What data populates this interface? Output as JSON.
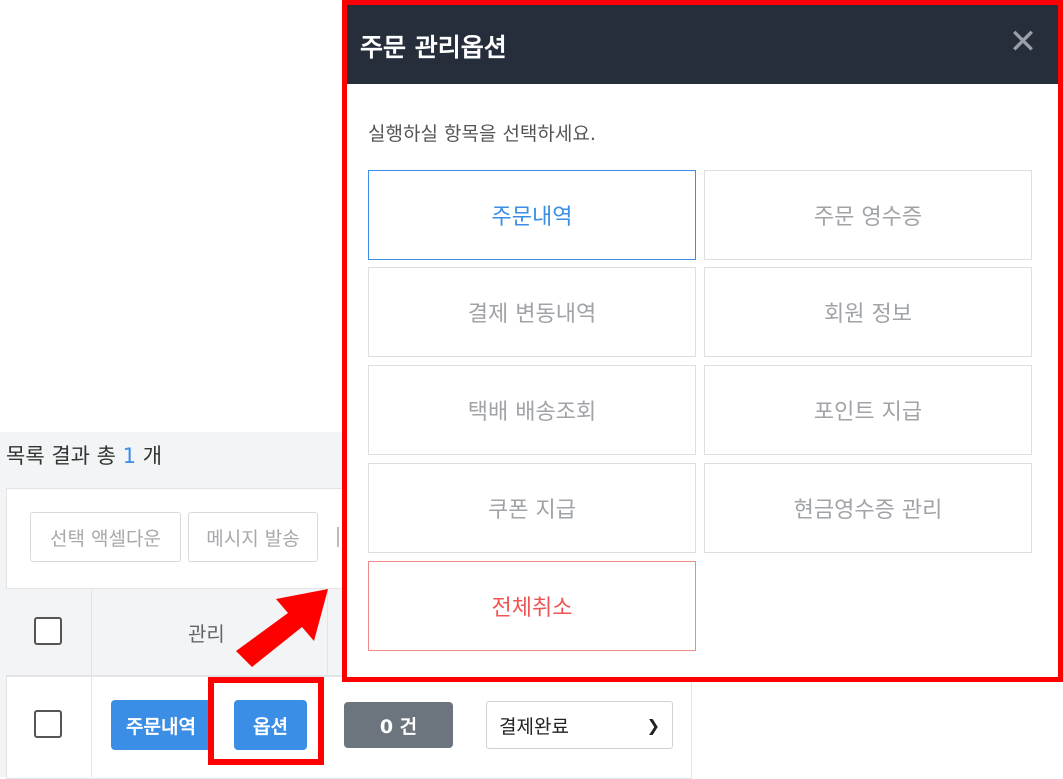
{
  "list": {
    "summary_prefix": "목록 결과 총",
    "summary_count": "1",
    "summary_suffix": "개",
    "toolbar": {
      "excel_label": "선택 액셀다운",
      "message_label": "메시지 발송"
    },
    "table": {
      "header_manage": "관리"
    },
    "row": {
      "order_detail_label": "주문내역",
      "option_label": "옵션",
      "count_label": "0 건",
      "status_value": "결제완료"
    }
  },
  "modal": {
    "title": "주문 관리옵션",
    "close_symbol": "✕",
    "description": "실행하실 항목을 선택하세요.",
    "options": [
      {
        "label": "주문내역"
      },
      {
        "label": "주문 영수증"
      },
      {
        "label": "결제 변동내역"
      },
      {
        "label": "회원 정보"
      },
      {
        "label": "택배 배송조회"
      },
      {
        "label": "포인트 지급"
      },
      {
        "label": "쿠폰 지급"
      },
      {
        "label": "현금영수증 관리"
      },
      {
        "label": "전체취소"
      }
    ]
  },
  "colors": {
    "accent": "#3a8ee6",
    "header_bg": "#262e3b",
    "danger": "#ef5555",
    "highlight": "#ff0000"
  }
}
